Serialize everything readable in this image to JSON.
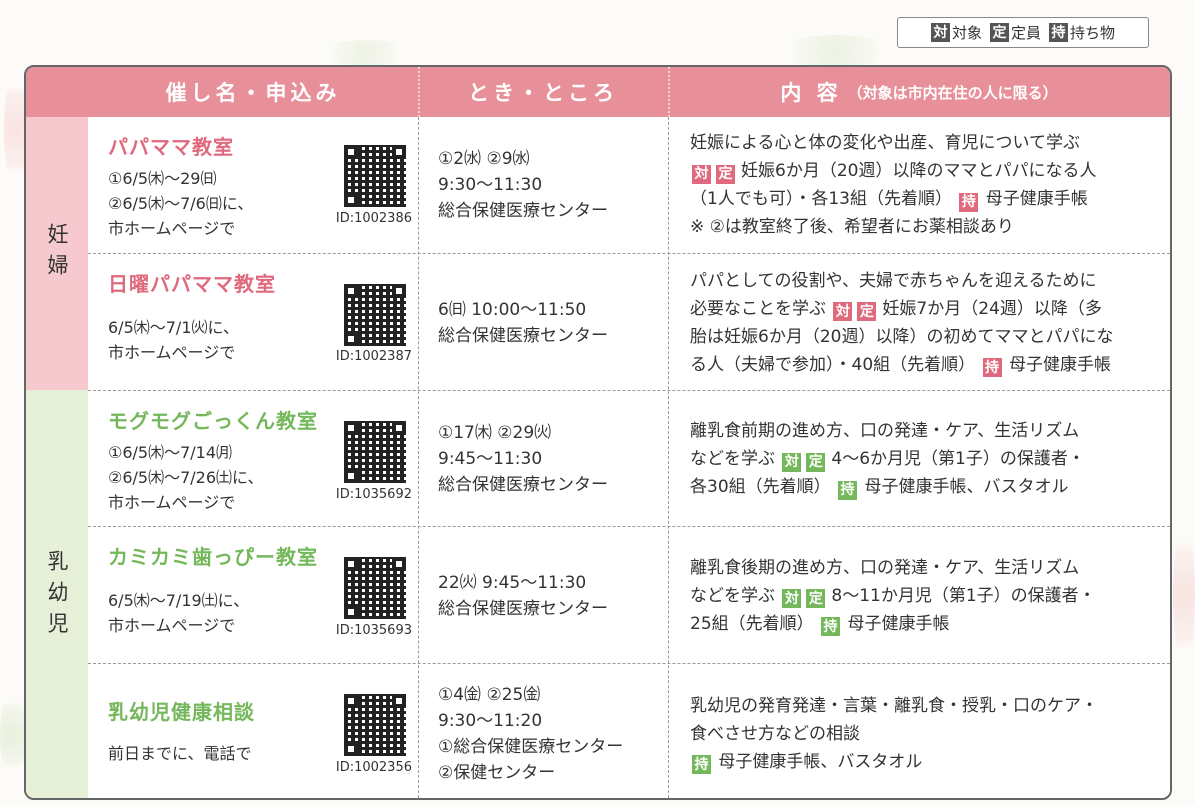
{
  "legend": [
    {
      "tag": "対",
      "label": "対象"
    },
    {
      "tag": "定",
      "label": "定員"
    },
    {
      "tag": "持",
      "label": "持ち物"
    }
  ],
  "header": {
    "col1": "催し名・申込み",
    "col2": "とき・ところ",
    "col3": "内 容",
    "col3_note": "（対象は市内在住の人に限る）"
  },
  "categories": {
    "pregnant": "妊婦",
    "infant": "乳幼児"
  },
  "rows": [
    {
      "title": "パパママ教室",
      "apply": [
        "①6/5㈭～29㈰",
        "②6/5㈭～7/6㈰に、",
        "市ホームページで"
      ],
      "id": "ID:1002386",
      "time": [
        "①2㈬ ②9㈬",
        "9:30～11:30",
        "総合保健医療センター"
      ],
      "desc": [
        {
          "text": "妊娠による心と体の変化や出産、育児について学ぶ"
        },
        {
          "tags": [
            "対",
            "定"
          ],
          "text": "妊娠6か月（20週）以降のママとパパになる人"
        },
        {
          "text": "（1人でも可）・各13組（先着順）",
          "tag2": "持",
          "text2": "母子健康手帳"
        },
        {
          "text": "※ ②は教室終了後、希望者にお薬相談あり"
        }
      ]
    },
    {
      "title": "日曜パパママ教室",
      "apply": [
        "6/5㈭～7/1㈫に、",
        "市ホームページで"
      ],
      "id": "ID:1002387",
      "time": [
        "6㈰ 10:00～11:50",
        "総合保健医療センター"
      ],
      "desc": [
        {
          "text": "パパとしての役割や、夫婦で赤ちゃんを迎えるために"
        },
        {
          "text": "必要なことを学ぶ",
          "tags2": [
            "対",
            "定"
          ],
          "text2": "妊娠7か月（24週）以降（多"
        },
        {
          "text": "胎は妊娠6か月（20週）以降）の初めてママとパパにな"
        },
        {
          "text": "る人（夫婦で参加）・40組（先着順）",
          "tag2": "持",
          "text2": "母子健康手帳"
        }
      ]
    },
    {
      "title": "モグモグごっくん教室",
      "apply": [
        "①6/5㈭～7/14㈪",
        "②6/5㈭～7/26㈯に、",
        "市ホームページで"
      ],
      "id": "ID:1035692",
      "time": [
        "①17㈭ ②29㈫",
        "9:45～11:30",
        "総合保健医療センター"
      ],
      "desc": [
        {
          "text": "離乳食前期の進め方、口の発達・ケア、生活リズム"
        },
        {
          "text": "などを学ぶ",
          "tags2": [
            "対",
            "定"
          ],
          "text2": "4～6か月児（第1子）の保護者・"
        },
        {
          "text": "各30組（先着順）",
          "tag2": "持",
          "text2": "母子健康手帳、バスタオル"
        }
      ]
    },
    {
      "title": "カミカミ歯っぴー教室",
      "apply": [
        "6/5㈭～7/19㈯に、",
        "市ホームページで"
      ],
      "id": "ID:1035693",
      "time": [
        "22㈫ 9:45～11:30",
        "総合保健医療センター"
      ],
      "desc": [
        {
          "text": "離乳食後期の進め方、口の発達・ケア、生活リズム"
        },
        {
          "text": "などを学ぶ",
          "tags2": [
            "対",
            "定"
          ],
          "text2": "8～11か月児（第1子）の保護者・"
        },
        {
          "text": "25組（先着順）",
          "tag2": "持",
          "text2": "母子健康手帳"
        }
      ]
    },
    {
      "title": "乳幼児健康相談",
      "apply": [
        "前日までに、電話で"
      ],
      "id": "ID:1002356",
      "time": [
        "①4㈮ ②25㈮",
        "9:30～11:20",
        "①総合保健医療センター",
        "②保健センター"
      ],
      "desc": [
        {
          "text": "乳幼児の発育発達・言葉・離乳食・授乳・口のケア・"
        },
        {
          "text": "食べさせ方などの相談"
        },
        {
          "tag": "持",
          "text": "母子健康手帳、バスタオル"
        }
      ]
    }
  ],
  "colors": {
    "header_bg": "#e89099",
    "pink_accent": "#e06a7d",
    "green_accent": "#74b85b",
    "pregnant_bg": "#f5c9cd",
    "infant_bg": "#e6efd8"
  }
}
